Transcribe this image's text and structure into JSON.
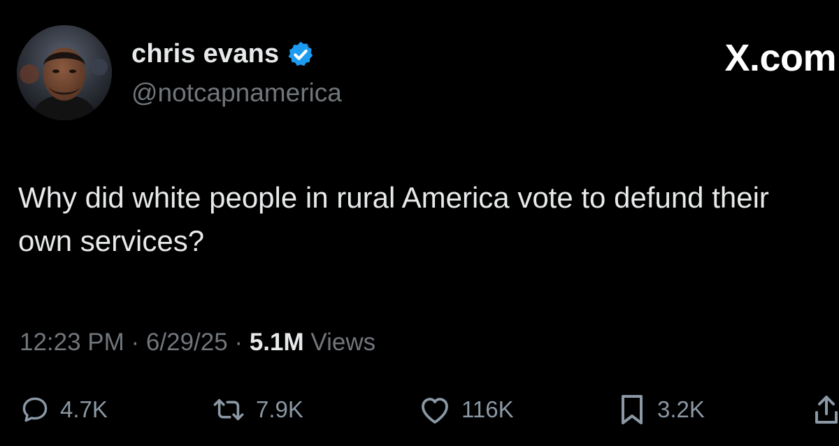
{
  "author": {
    "display_name": "chris evans",
    "handle": "@notcapnamerica",
    "verified": true,
    "avatar": "profile-photo"
  },
  "site_label": "X.com",
  "tweet": {
    "text": "Why did white people in rural America vote to defund their own services?"
  },
  "meta": {
    "time": "12:23 PM",
    "date": "6/29/25",
    "views_count": "5.1M",
    "views_label": "Views",
    "separator": " · "
  },
  "actions": {
    "replies": "4.7K",
    "reposts": "7.9K",
    "likes": "116K",
    "bookmarks": "3.2K"
  },
  "colors": {
    "background": "#000000",
    "text_primary": "#e7e9ea",
    "text_secondary": "#71767b",
    "verified_badge": "#1d9bf0"
  },
  "icons": [
    "verified-badge-icon",
    "reply-icon",
    "repost-icon",
    "like-icon",
    "bookmark-icon",
    "share-icon"
  ]
}
